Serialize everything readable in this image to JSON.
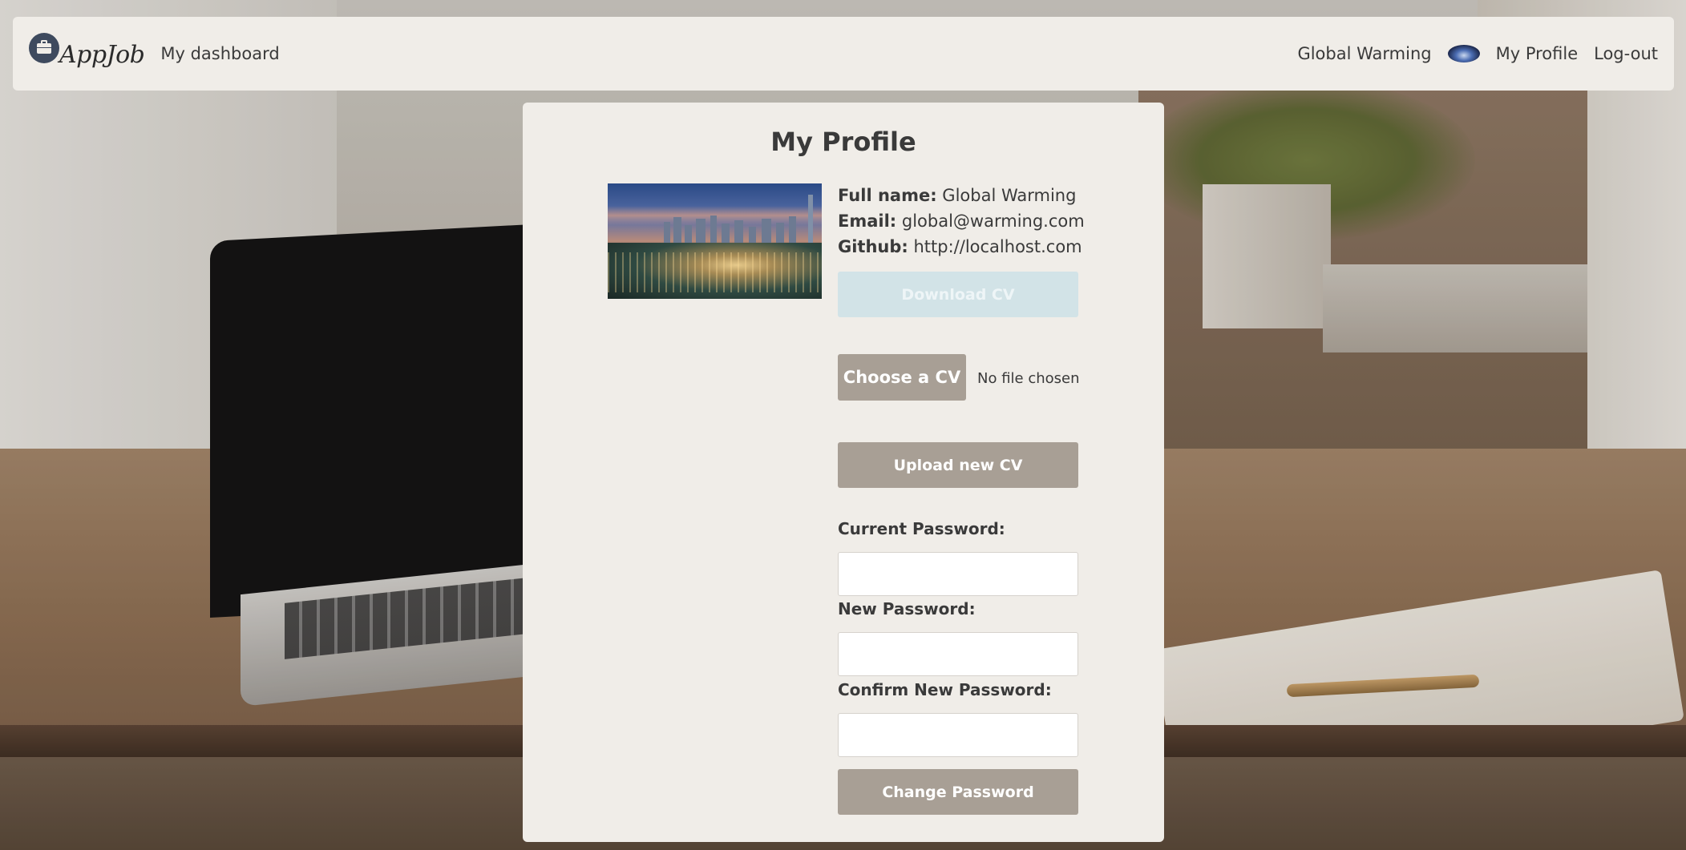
{
  "navbar": {
    "brand": "AppJob",
    "dashboard_link": "My dashboard",
    "user_name": "Global Warming",
    "profile_link": "My Profile",
    "logout_link": "Log-out"
  },
  "profile": {
    "title": "My Profile",
    "full_name_label": "Full name:",
    "full_name": "Global Warming",
    "email_label": "Email:",
    "email": "global@warming.com",
    "github_label": "Github:",
    "github": "http://localhost.com"
  },
  "cv": {
    "download_label": "Download CV",
    "choose_label": "Choose a CV",
    "file_status": "No file chosen",
    "upload_label": "Upload new CV"
  },
  "password": {
    "current_label": "Current Password:",
    "current_value": "",
    "new_label": "New Password:",
    "new_value": "",
    "confirm_label": "Confirm New Password:",
    "confirm_value": "",
    "change_label": "Change Password"
  },
  "icons": {
    "brand_icon": "briefcase-icon"
  },
  "colors": {
    "surface": "#f0ede8",
    "button": "#a89f95",
    "button_disabled": "#d2e3e7",
    "brand_circle": "#3e4a5e",
    "text": "#3a3a3a"
  }
}
